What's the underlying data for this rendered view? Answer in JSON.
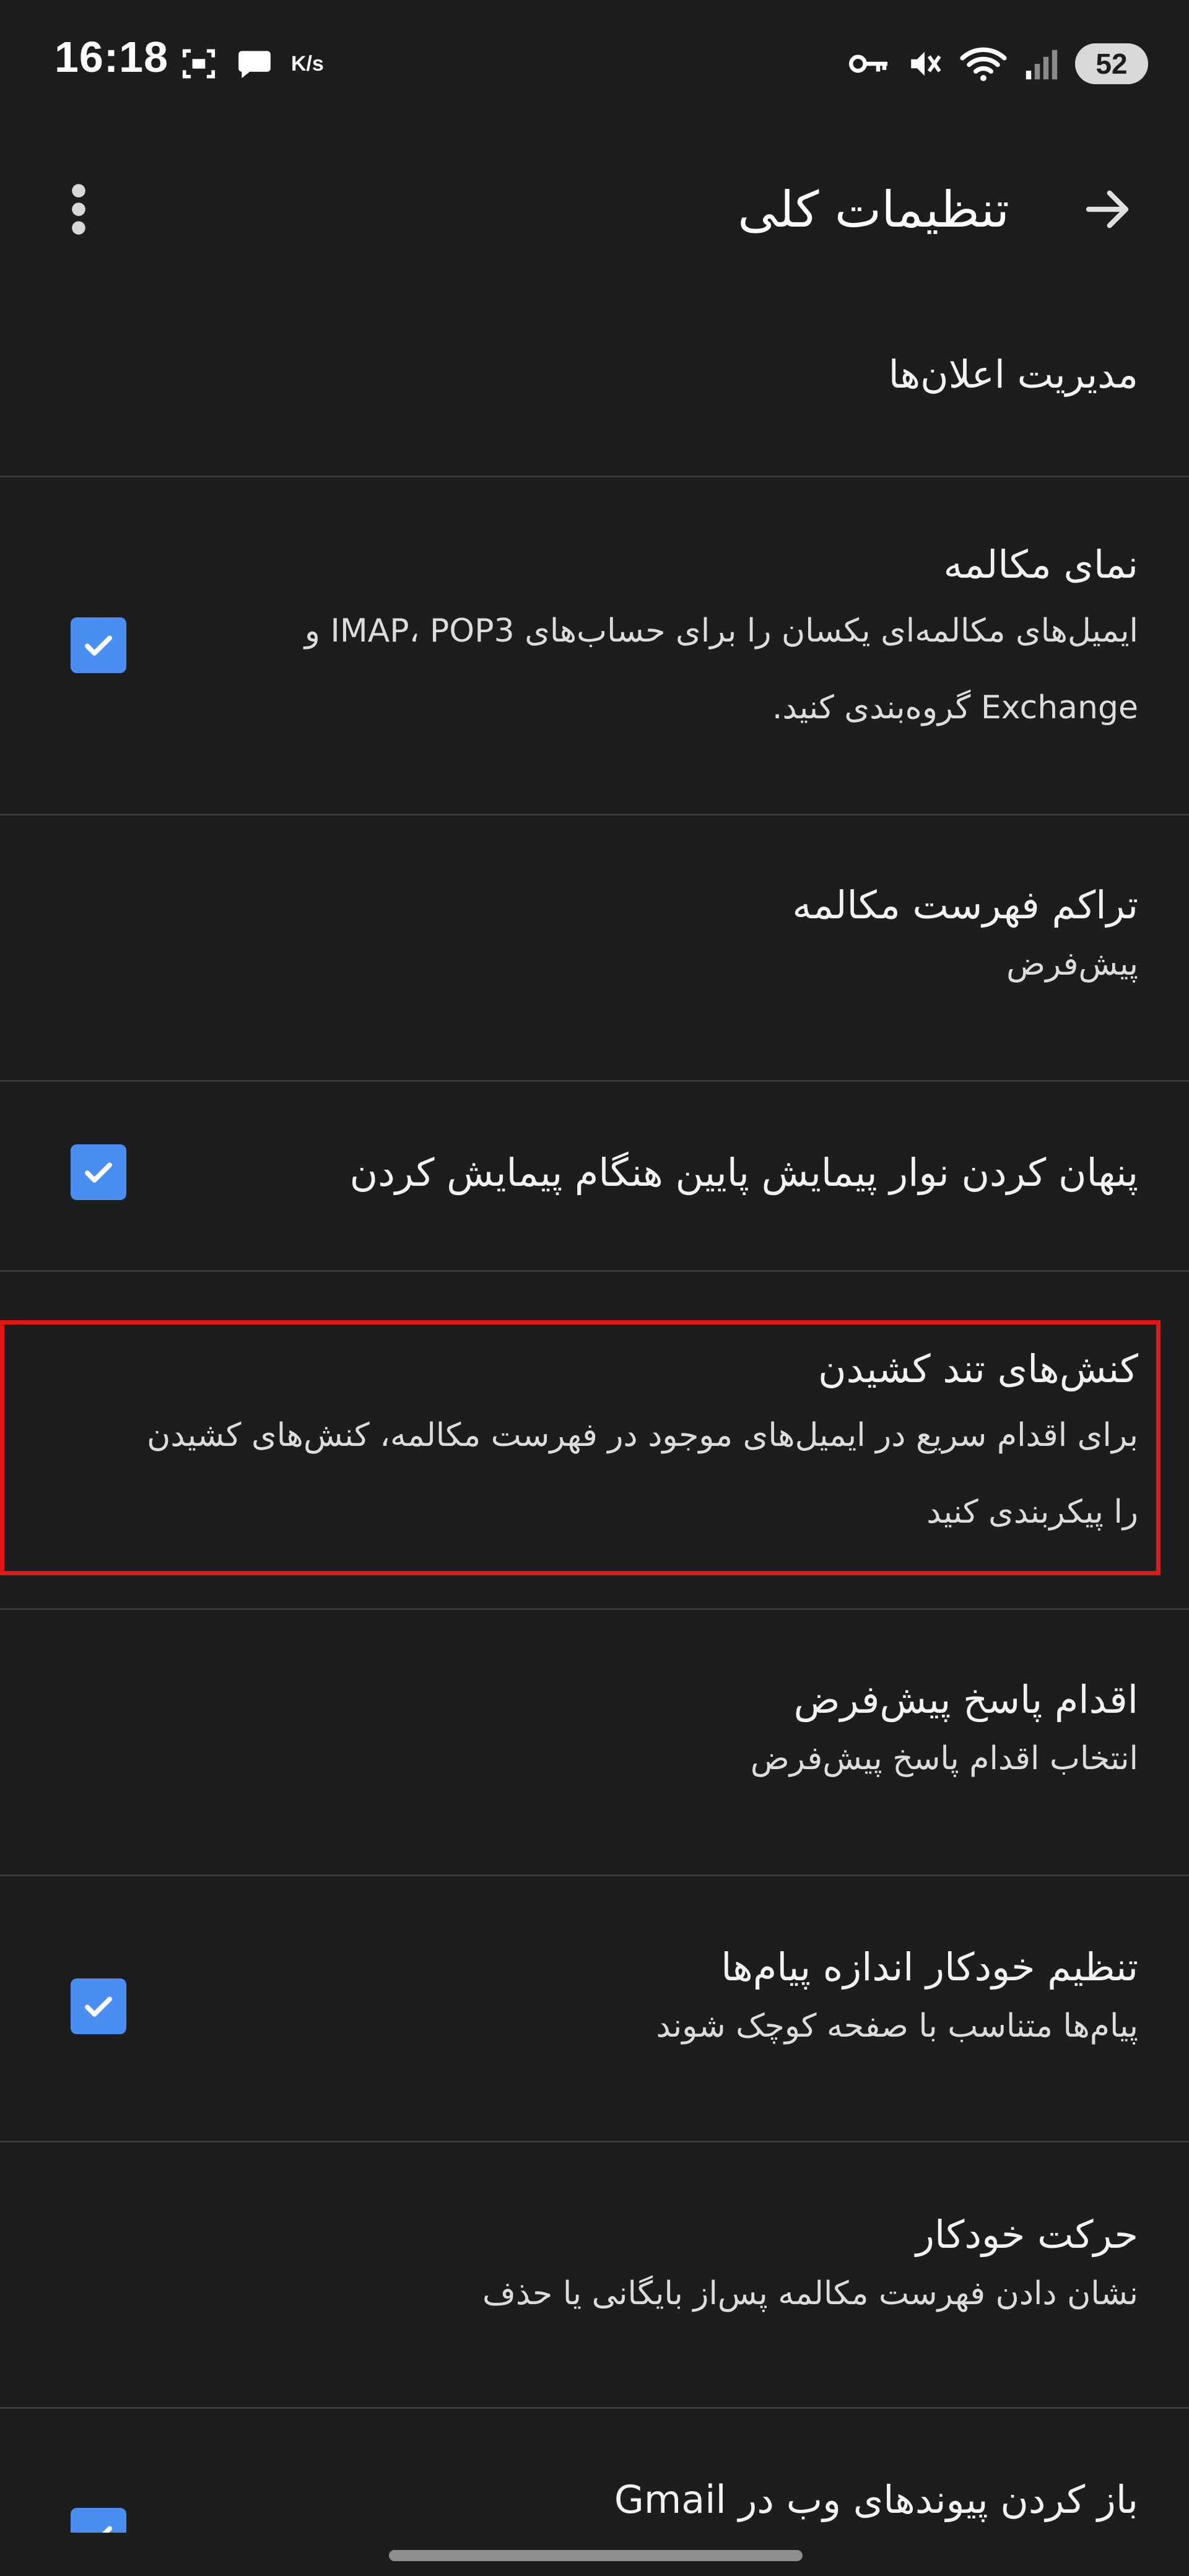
{
  "status_bar": {
    "time": "16:18",
    "net_speed": "K/s",
    "battery": "52",
    "left_icons": [
      "screenshot-icon",
      "chat-bubble-icon",
      "network-speed-icon"
    ],
    "right_icons": [
      "vpn-key-icon",
      "muted-vibrate-icon",
      "wifi-icon",
      "signal-icon",
      "battery-icon"
    ]
  },
  "app_bar": {
    "title": "تنظیمات کلی",
    "back_icon": "arrow-back-icon",
    "overflow_icon": "more-vert-icon"
  },
  "settings": [
    {
      "title": "مدیریت اعلان‌ها"
    },
    {
      "title": "نمای مکالمه",
      "summary": "ایمیل‌های مکالمه‌ای یکسان را برای حساب‌های IMAP، POP3 و Exchange گروه‌بندی کنید.",
      "checked": true
    },
    {
      "title": "تراکم فهرست مکالمه",
      "summary": "پیش‌فرض"
    },
    {
      "title": "پنهان کردن نوار پیمایش پایین هنگام پیمایش کردن",
      "checked": true
    },
    {
      "title": "کنش‌های تند کشیدن",
      "summary": "برای اقدام سریع در ایمیل‌های موجود در فهرست مکالمه، کنش‌های کشیدن را پیکربندی کنید",
      "highlighted": true
    },
    {
      "title": "اقدام پاسخ پیش‌فرض",
      "summary": "انتخاب اقدام پاسخ پیش‌فرض"
    },
    {
      "title": "تنظیم خودکار اندازه پیام‌ها",
      "summary": "پیام‌ها متناسب با صفحه کوچک شوند",
      "checked": true
    },
    {
      "title": "حرکت خودکار",
      "summary": "نشان دادن فهرست مکالمه پس‌از بایگانی یا حذف"
    },
    {
      "title": "باز کردن پیوندهای وب در Gmail",
      "checked": true
    }
  ],
  "colors": {
    "background": "#1d1d1f",
    "checkbox": "#4a8ef2",
    "highlight": "#e01818",
    "divider": "#3a3a3c"
  }
}
